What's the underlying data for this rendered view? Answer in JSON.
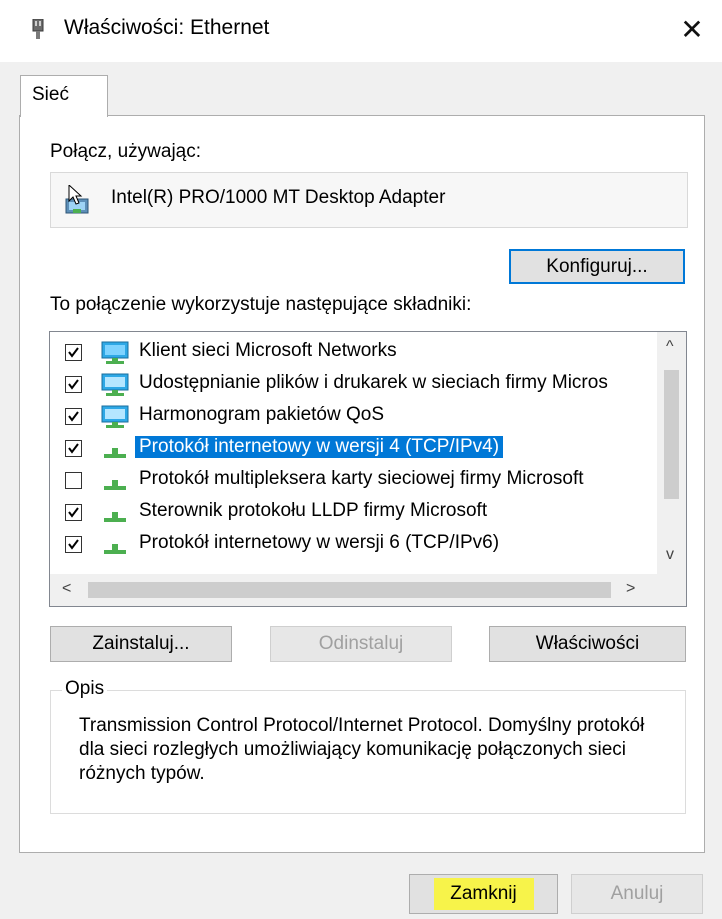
{
  "window": {
    "title": "Właściwości: Ethernet",
    "close_glyph": "✕"
  },
  "tabs": [
    {
      "label": "Sieć",
      "active": true
    }
  ],
  "connect_using": {
    "label": "Połącz, używając:",
    "adapter_name": "Intel(R) PRO/1000 MT Desktop Adapter",
    "configure_button": "Konfiguruj..."
  },
  "components": {
    "label": "To połączenie wykorzystuje następujące składniki:",
    "items": [
      {
        "label": "Klient sieci Microsoft Networks",
        "checked": true,
        "icon": "network-client-icon",
        "selected": false
      },
      {
        "label": "Udostępnianie plików i drukarek w sieciach firmy Micros",
        "checked": true,
        "icon": "network-service-icon",
        "selected": false
      },
      {
        "label": "Harmonogram pakietów QoS",
        "checked": true,
        "icon": "network-service-icon",
        "selected": false
      },
      {
        "label": "Protokół internetowy w wersji 4 (TCP/IPv4)",
        "checked": true,
        "icon": "network-protocol-icon",
        "selected": true
      },
      {
        "label": "Protokół multipleksera karty sieciowej firmy Microsoft",
        "checked": false,
        "icon": "network-protocol-icon",
        "selected": false
      },
      {
        "label": "Sterownik protokołu LLDP firmy Microsoft",
        "checked": true,
        "icon": "network-protocol-icon",
        "selected": false
      },
      {
        "label": "Protokół internetowy w wersji 6 (TCP/IPv6)",
        "checked": true,
        "icon": "network-protocol-icon",
        "selected": false
      }
    ],
    "scroll_up": "^",
    "scroll_down": "v",
    "scroll_left": "<",
    "scroll_right": ">"
  },
  "component_buttons": {
    "install": "Zainstaluj...",
    "uninstall": "Odinstaluj",
    "properties": "Właściwości"
  },
  "description": {
    "legend": "Opis",
    "text": "Transmission Control Protocol/Internet Protocol. Domyślny protokół dla sieci rozległych umożliwiający komunikację połączonych sieci różnych typów."
  },
  "dialog_buttons": {
    "close": "Zamknij",
    "cancel": "Anuluj"
  },
  "colors": {
    "selection": "#0078d7",
    "highlight": "#f7f34a",
    "panel_bg": "#f0f0f0"
  }
}
